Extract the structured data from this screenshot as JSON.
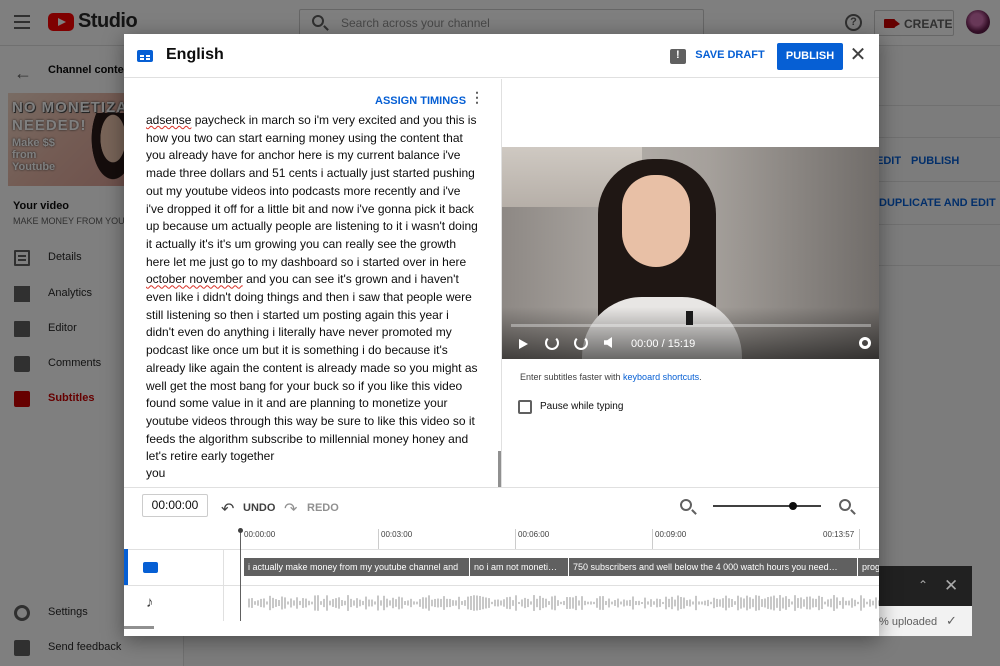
{
  "topbar": {
    "logo_text": "Studio",
    "search_placeholder": "Search across your channel",
    "help_glyph": "?",
    "create_label": "CREATE"
  },
  "sidebar": {
    "back_label": "Channel content",
    "thumbnail_text": {
      "line1": "NO MONETIZA",
      "line2": "NEEDED!",
      "line3": "Make $$ from Youtube"
    },
    "your_video_label": "Your video",
    "video_title": "MAKE MONEY FROM YOUTUBE",
    "items": [
      {
        "label": "Details",
        "icon": "details-icon",
        "active": false
      },
      {
        "label": "Analytics",
        "icon": "analytics-icon",
        "active": false
      },
      {
        "label": "Editor",
        "icon": "editor-icon",
        "active": false
      },
      {
        "label": "Comments",
        "icon": "comments-icon",
        "active": false
      },
      {
        "label": "Subtitles",
        "icon": "subtitles-icon",
        "active": true
      }
    ],
    "bottom_items": [
      {
        "label": "Settings",
        "icon": "gear-icon"
      },
      {
        "label": "Send feedback",
        "icon": "feedback-icon"
      }
    ]
  },
  "background_page": {
    "edit_label": "EDIT",
    "publish_label": "PUBLISH",
    "duplicate_label": "DUPLICATE AND EDIT"
  },
  "dialog": {
    "title": "English",
    "save_draft_label": "SAVE DRAFT",
    "publish_label": "PUBLISH",
    "close_glyph": "✕",
    "assign_timings_label": "ASSIGN TIMINGS",
    "kebab_glyph": "⋮",
    "transcript": {
      "p1": "adsense",
      "p2": " paycheck in march so i'm very excited and you this is how you two can start earning money using the content that you already have for anchor here is my current balance i've made three dollars and 51 cents i actually just started pushing out my youtube videos into podcasts more recently and i've i've dropped it off for a little bit and now i've gonna pick it back up because um actually people are listening to it i wasn't doing it actually it's it's um growing you can really see the growth here let me just go to my dashboard so i started over in here ",
      "p3": "october november",
      "p4": " and you can see it's grown and i haven't even like i didn't doing things and then i saw that people were still listening so then i started um posting again this year i didn't even do anything i literally have never promoted my podcast like once um but it is something i do because it's already like again the content is already made so you might as well get the most bang for your buck so if you like this video found some value in it and are planning to monetize your youtube videos through this way be sure to like this video so it feeds the algorithm subscribe to millennial money honey and let's retire early together",
      "last_line": "you"
    },
    "player": {
      "time": "00:00 / 15:19"
    },
    "hint": {
      "text": "Enter subtitles faster with ",
      "link": "keyboard shortcuts",
      "end": "."
    },
    "pause_while_typing_label": "Pause while typing",
    "pause_while_typing_checked": false,
    "timeline": {
      "current_time": "00:00:00",
      "undo_label": "UNDO",
      "redo_label": "REDO",
      "ruler_labels": [
        "00:00:00",
        "00:03:00",
        "00:06:00",
        "00:09:00",
        "00:13:57"
      ],
      "zoom_level": 0.74,
      "segments": [
        "i actually make money from my youtube channel and",
        "no i am not moneti…",
        "750 subscribers and well below the 4 000 watch  hours you need…",
        "prog"
      ]
    }
  },
  "upload_toast": {
    "status_text": "% uploaded",
    "check_glyph": "✓",
    "collapse_glyph": "⌃",
    "close_glyph": "✕"
  },
  "colors": {
    "accent": "#065fd4",
    "brand_red": "#ff0000",
    "subtitles_active": "#cc0000",
    "spellcheck": "#d93025"
  }
}
